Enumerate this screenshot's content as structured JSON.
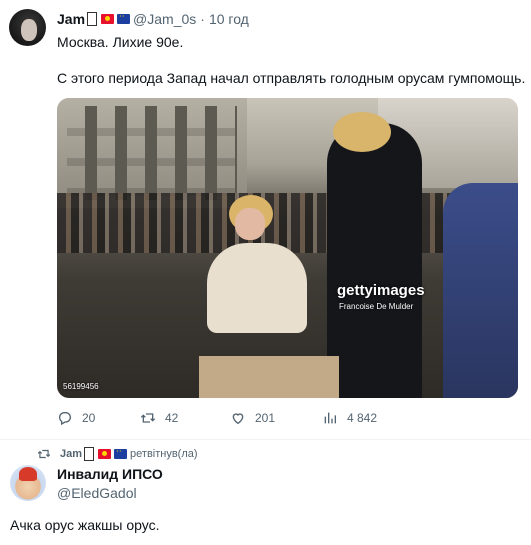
{
  "tweet": {
    "author_name": "Jam",
    "handle": "@Jam_0s",
    "separator": "·",
    "time": "10 год",
    "line1": "Москва. Лихие 90е.",
    "line2": "С этого периода Запад начал отправлять голодным орусам гумпомощь.",
    "image": {
      "watermark": "gettyimages",
      "credit": "Francoise De Mulder",
      "photo_id": "56199456"
    },
    "actions": {
      "replies": "20",
      "retweets": "42",
      "likes": "201",
      "views": "4 842"
    }
  },
  "retweet_bar": {
    "name": "Jam",
    "label": "ретвітнув(ла)"
  },
  "reply": {
    "author_name": "Инвалид ИПСО",
    "handle": "@EledGadol",
    "text": "Ачка орус жакшы орус."
  },
  "icons": [
    "flag-kg-icon",
    "flag-eu-icon",
    "reply-icon",
    "retweet-icon",
    "like-icon",
    "views-icon"
  ],
  "colors": {
    "text": "#0f1419",
    "muted": "#536471",
    "divider": "#eff3f4"
  }
}
